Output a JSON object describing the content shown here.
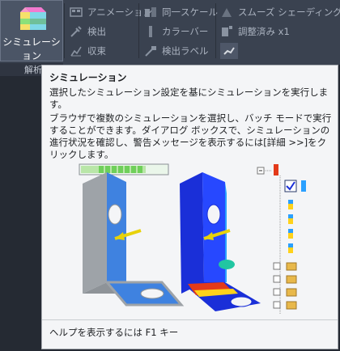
{
  "ribbon": {
    "simulation_button": "シミュレーション",
    "panel_label": "解析",
    "col1": [
      {
        "icon": "animation-icon",
        "label": "アニメーション"
      },
      {
        "icon": "inspect-icon",
        "label": "検出"
      },
      {
        "icon": "converge-icon",
        "label": "収束"
      }
    ],
    "col2": [
      {
        "icon": "same-scale-icon",
        "label": "同一スケール"
      },
      {
        "icon": "colorbar-icon",
        "label": "カラーバー"
      },
      {
        "icon": "probe-label-icon",
        "label": "検出ラベル"
      }
    ],
    "col3": [
      {
        "icon": "smooth-shading-icon",
        "label": "スムーズ シェーディング"
      },
      {
        "icon": "adjusted-scale-icon",
        "label": "調整済み x1"
      },
      {
        "icon": "deform-icon",
        "label": ""
      }
    ]
  },
  "tooltip": {
    "title": "シミュレーション",
    "description": "選択したシミュレーション設定を基にシミュレーションを実行します。",
    "detail": "ブラウザで複数のシミュレーションを選択し、バッチ モードで実行することができます。ダイアログ ボックスで、シミュレーションの進行状況を確認し、警告メッセージを表示するには[詳細 >>]をクリックします。",
    "footer": "ヘルプを表示するには F1 キー"
  },
  "colors": {
    "ribbon_bg": "#3a4250",
    "tooltip_bg": "#f4f5f7",
    "bracket_plain": "#3f82e0",
    "bracket_blue": "#1a2fd8",
    "stress_red": "#e33a1a",
    "arrow_yellow": "#e8d20a"
  }
}
